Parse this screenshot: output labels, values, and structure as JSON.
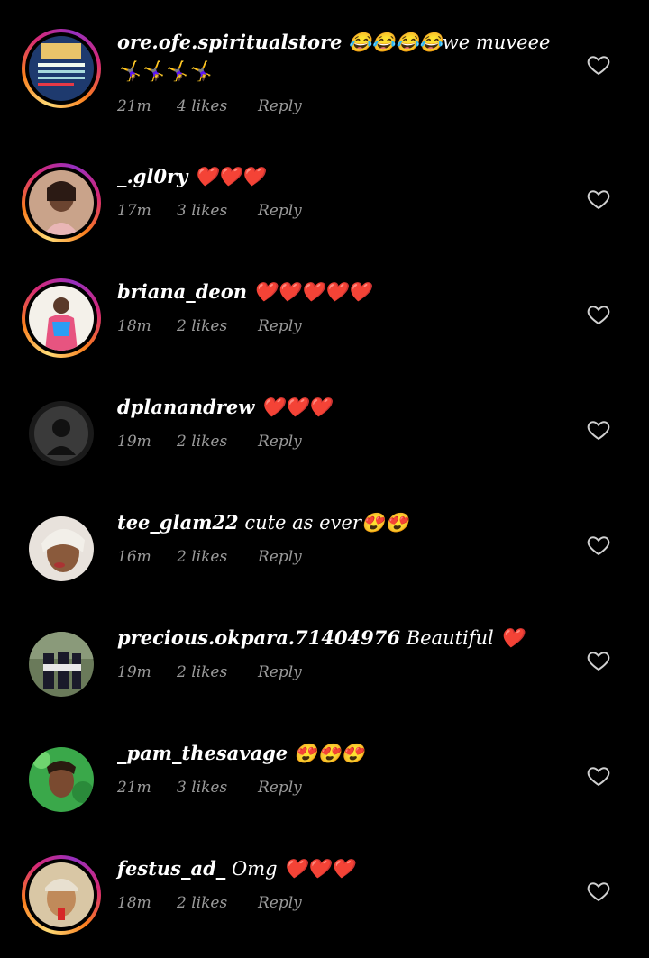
{
  "comments": [
    {
      "username": "ore.ofe.spiritualstore",
      "text": " 😂😂😂😂we muveee 🤸‍♀️🤸‍♀️🤸‍♀️🤸‍♀️",
      "time": "21m",
      "likes": "4 likes",
      "reply": "Reply",
      "story_ring": true
    },
    {
      "username": "_.gl0ry",
      "text": " ❤️❤️❤️",
      "time": "17m",
      "likes": "3 likes",
      "reply": "Reply",
      "story_ring": true
    },
    {
      "username": "briana_deon",
      "text": " ❤️❤️❤️❤️❤️",
      "time": "18m",
      "likes": "2 likes",
      "reply": "Reply",
      "story_ring": true
    },
    {
      "username": "dplanandrew",
      "text": " ❤️❤️❤️",
      "time": "19m",
      "likes": "2 likes",
      "reply": "Reply",
      "story_ring": false
    },
    {
      "username": "tee_glam22",
      "text": " cute as ever😍😍",
      "time": "16m",
      "likes": "2 likes",
      "reply": "Reply",
      "story_ring": false
    },
    {
      "username": "precious.okpara.71404976",
      "text": " Beautiful ❤️",
      "time": "19m",
      "likes": "2 likes",
      "reply": "Reply",
      "story_ring": false
    },
    {
      "username": "_pam_thesavage",
      "text": " 😍😍😍",
      "time": "21m",
      "likes": "3 likes",
      "reply": "Reply",
      "story_ring": false
    },
    {
      "username": "festus_ad_",
      "text": " Omg ❤️❤️❤️",
      "time": "18m",
      "likes": "2 likes",
      "reply": "Reply",
      "story_ring": true
    }
  ],
  "colors": {
    "background": "#000000",
    "text": "#ffffff",
    "meta": "#9a9a9a",
    "heart_outline": "#d0d0d0"
  },
  "icons": {
    "like": "heart-outline-icon"
  }
}
